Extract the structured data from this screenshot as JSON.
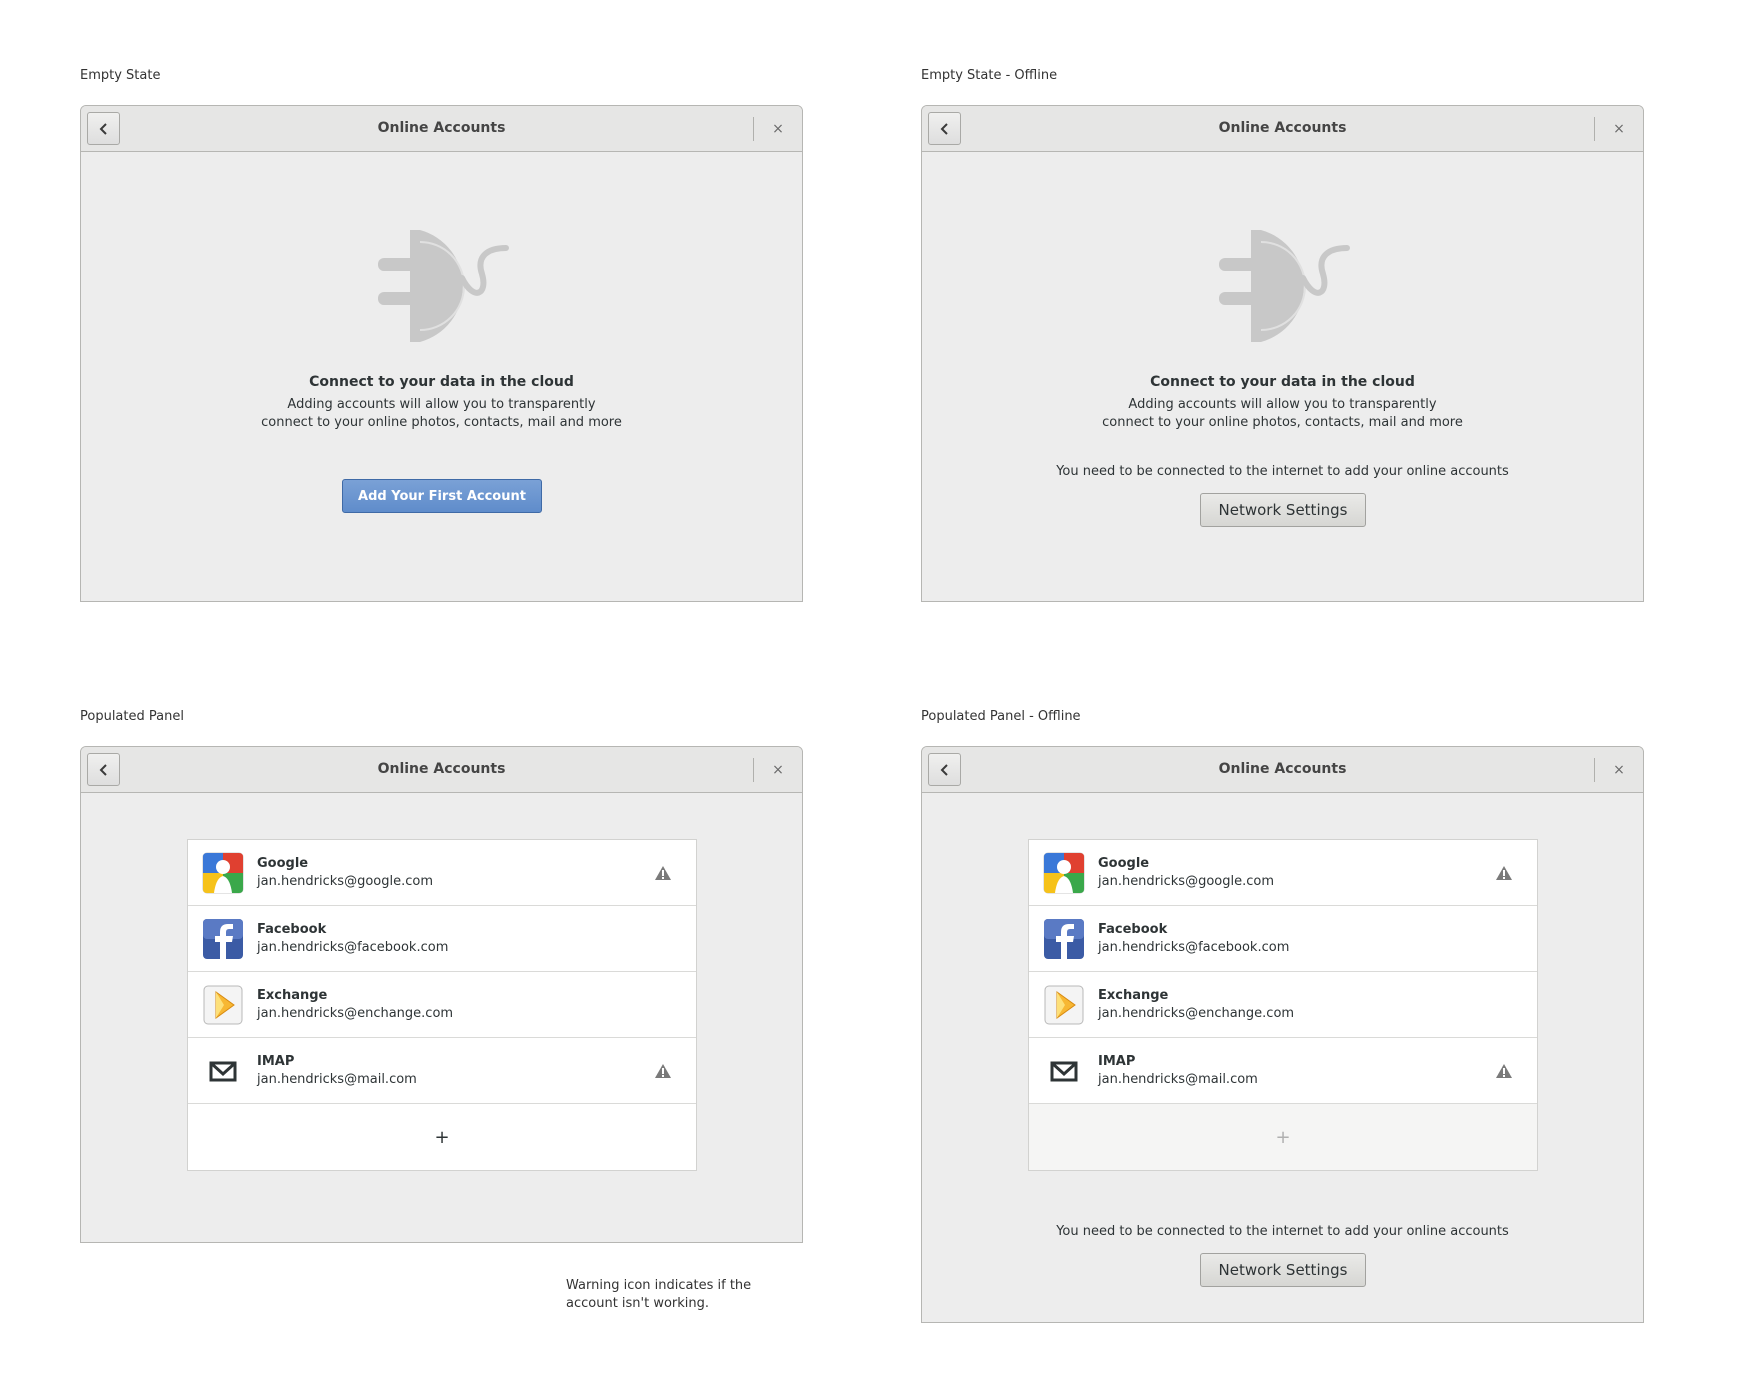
{
  "captions": {
    "empty": "Empty State",
    "empty_offline": "Empty State - Offline",
    "populated": "Populated Panel",
    "populated_offline": "Populated Panel - Offline"
  },
  "window": {
    "title": "Online Accounts",
    "close_glyph": "×"
  },
  "empty_state": {
    "icon": "online-accounts-plug-icon",
    "headline": "Connect to your data in the cloud",
    "desc_line1": "Adding accounts will allow you to transparently",
    "desc_line2": "connect to your online photos, contacts, mail and more",
    "add_first_label": "Add Your First Account"
  },
  "offline": {
    "message": "You need to be connected to the internet to add your online accounts",
    "network_settings_label": "Network Settings"
  },
  "accounts": [
    {
      "name": "Google",
      "email": "jan.hendricks@google.com",
      "icon": "google-icon",
      "warning": true
    },
    {
      "name": "Facebook",
      "email": "jan.hendricks@facebook.com",
      "icon": "facebook-icon",
      "warning": false
    },
    {
      "name": "Exchange",
      "email": "jan.hendricks@enchange.com",
      "icon": "exchange-icon",
      "warning": false
    },
    {
      "name": "IMAP",
      "email": "jan.hendricks@mail.com",
      "icon": "mail-icon",
      "warning": true
    }
  ],
  "add_glyph": "+",
  "note": {
    "line1": "Warning icon indicates if the",
    "line2": "account isn't working."
  },
  "colors": {
    "primary_button": "#6a95d0",
    "window_bg": "#ededed",
    "warning_icon": "#7a7a7a"
  }
}
